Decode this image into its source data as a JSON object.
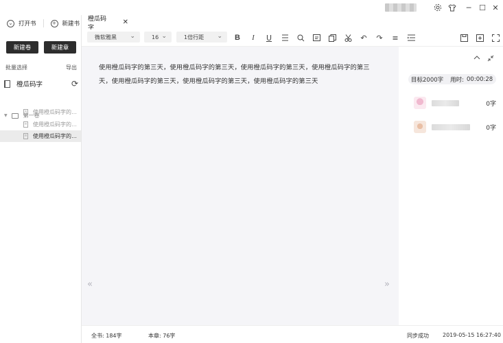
{
  "app": {
    "window_controls": {
      "settings_icon": "gear-icon",
      "skin_icon": "shirt-icon",
      "minimize": "─",
      "maximize": "☐",
      "close": "✕"
    }
  },
  "sidebar": {
    "open_book": "打开书",
    "new_book": "新建书",
    "new_volume_button": "新建卷",
    "new_chapter_button": "新建章",
    "batch_select": "批量选择",
    "export": "导出",
    "book_title": "橙瓜码字",
    "volume": "第一卷",
    "chapters": [
      {
        "label": "使用橙瓜码字的…",
        "active": false
      },
      {
        "label": "使用橙瓜码字的…",
        "active": false
      },
      {
        "label": "使用橙瓜码字的…",
        "active": true
      }
    ]
  },
  "tab": {
    "label": "橙瓜码字",
    "close": "✕"
  },
  "toolbar": {
    "font": "微软雅黑",
    "size": "16",
    "line_spacing": "1倍行距",
    "tools": [
      "bold-icon",
      "italic-icon",
      "underline-icon",
      "strikethrough-icon",
      "search-icon",
      "note-icon",
      "copy-icon",
      "cut-icon",
      "undo-icon",
      "redo-icon",
      "align-icon",
      "indent-icon",
      "save-icon",
      "export-icon",
      "fullscreen-icon"
    ]
  },
  "editor": {
    "content": "使用橙瓜码字的第三天，使用橙瓜码字的第三天，使用橙瓜码字的第三天，使用橙瓜码字的第三天，使用橙瓜码字的第三天，使用橙瓜码字的第三天，使用橙瓜码字的第三天",
    "prev_page": "«",
    "next_page": "»"
  },
  "right_panel": {
    "goal": "目标2000字",
    "time_label": "用时:",
    "time_value": "00:00:28",
    "users": [
      {
        "count": "0字",
        "avatar_color": "#f3d6e3"
      },
      {
        "count": "0字",
        "avatar_color": "#f1d9c6"
      }
    ]
  },
  "status": {
    "total": "全书: 184字",
    "chapter": "本章: 76字",
    "sync": "同步成功",
    "timestamp": "2019-05-15 16:27:40"
  }
}
